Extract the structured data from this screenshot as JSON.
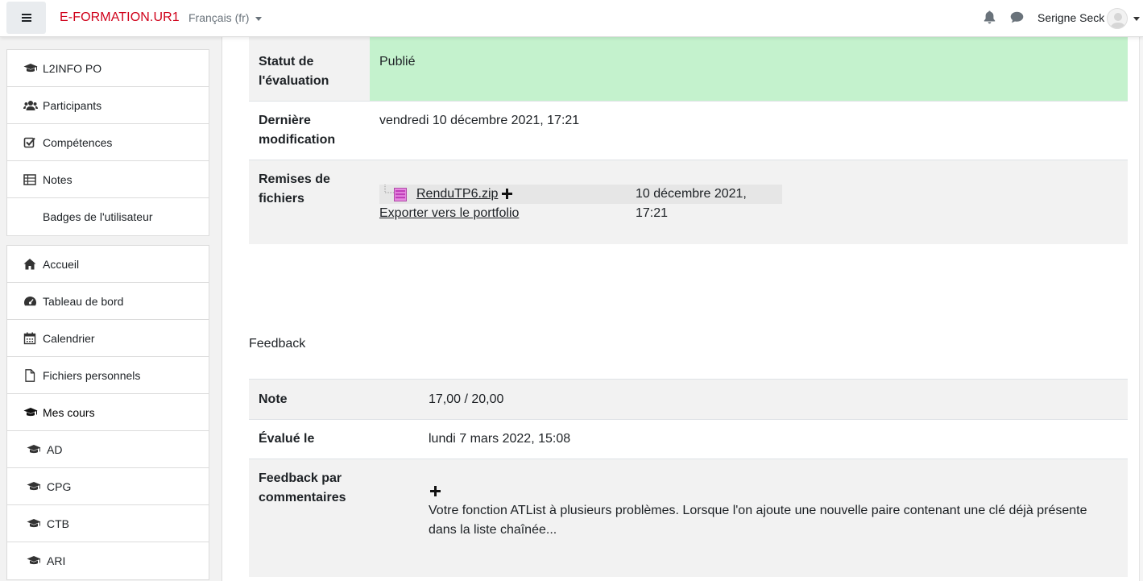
{
  "navbar": {
    "brand": "E-FORMATION.UR1",
    "language": "Français (fr)",
    "user_name": "Serigne Seck"
  },
  "drawer": {
    "course_items": [
      {
        "label": "L2INFO PO",
        "icon": "graduation-cap-icon"
      },
      {
        "label": "Participants",
        "icon": "users-icon"
      },
      {
        "label": "Compétences",
        "icon": "checkbox-icon"
      },
      {
        "label": "Notes",
        "icon": "table-icon"
      },
      {
        "label": "Badges de l'utilisateur",
        "icon": ""
      }
    ],
    "site_items": [
      {
        "label": "Accueil",
        "icon": "home-icon"
      },
      {
        "label": "Tableau de bord",
        "icon": "dashboard-icon"
      },
      {
        "label": "Calendrier",
        "icon": "calendar-icon"
      },
      {
        "label": "Fichiers personnels",
        "icon": "file-icon"
      },
      {
        "label": "Mes cours",
        "icon": "graduation-cap-icon"
      },
      {
        "label": "AD",
        "icon": "graduation-cap-icon"
      },
      {
        "label": "CPG",
        "icon": "graduation-cap-icon"
      },
      {
        "label": "CTB",
        "icon": "graduation-cap-icon"
      },
      {
        "label": "ARI",
        "icon": "graduation-cap-icon"
      }
    ]
  },
  "submission": {
    "status_label": "Statut de l'évaluation",
    "status_value": "Publié",
    "status_color": "#c4f2cd",
    "modified_label": "Dernière modification",
    "modified_value": "vendredi 10 décembre 2021, 17:21",
    "files_label": "Remises de fichiers",
    "file_name": "RenduTP6.zip",
    "file_date": "10 décembre 2021, 17:21",
    "export_link": "Exporter vers le portfolio"
  },
  "feedback": {
    "heading": "Feedback",
    "grade_label": "Note",
    "grade_value": "17,00 / 20,00",
    "graded_on_label": "Évalué le",
    "graded_on_value": "lundi 7 mars 2022, 15:08",
    "comments_label": "Feedback par commentaires",
    "comments_value": "Votre fonction ATList à plusieurs problèmes. Lorsque l'on ajoute une nouvelle paire contenant une clé déjà présente dans la liste chaînée..."
  }
}
